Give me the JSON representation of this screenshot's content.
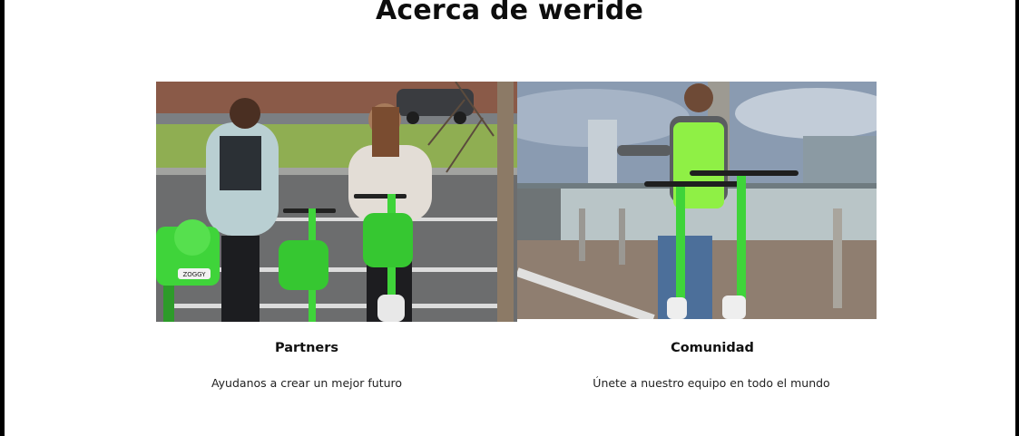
{
  "page": {
    "title": "Acerca de weride"
  },
  "cards": [
    {
      "title": "Partners",
      "description": "Ayudanos a crear un mejor futuro",
      "photo": "photo-two-people-with-green-scooters"
    },
    {
      "title": "Comunidad",
      "description": "Únete a nuestro equipo en todo el mundo",
      "photo": "photo-worker-in-green-vest-with-scooters"
    }
  ],
  "brand": {
    "scooter_badge": "ZOGGY",
    "accent_color": "#3fd43a"
  }
}
